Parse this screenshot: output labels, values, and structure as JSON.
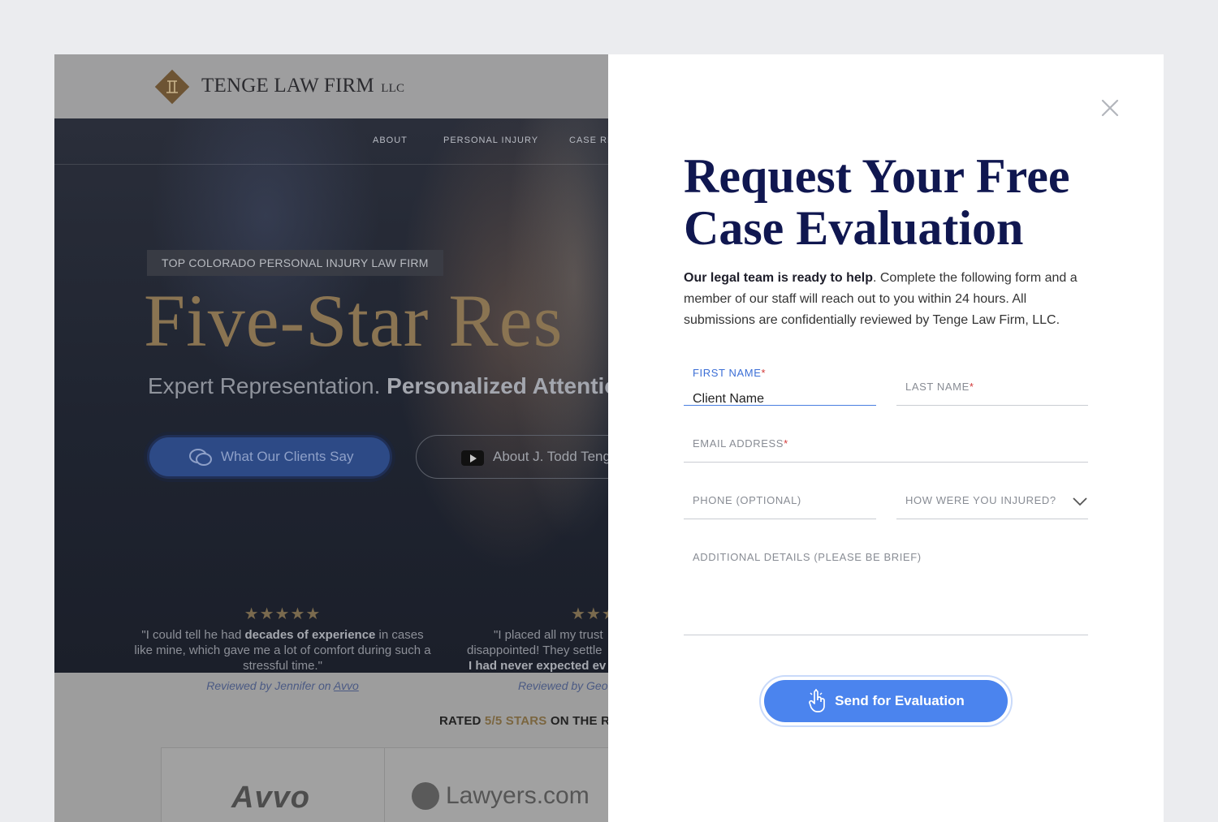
{
  "site": {
    "logo_text": "TENGE LAW FIRM",
    "logo_suffix": "LLC",
    "nav": [
      "ABOUT",
      "PERSONAL INJURY",
      "CASE RE"
    ],
    "eyebrow": "TOP COLORADO PERSONAL INJURY LAW FIRM",
    "hero_title": "Five-Star Res",
    "hero_sub_light": "Expert Representation.",
    "hero_sub_bold": "Personalized Attentio",
    "clients_button": "What Our Clients Say",
    "about_button": "About J. Todd Teng",
    "reviews": [
      {
        "stars": "★★★★★",
        "pre": "\"I could tell he had ",
        "bold": "decades of experience",
        "post": " in cases like mine, which gave me a lot of comfort during such a stressful time.\"",
        "by_pre": "Reviewed by Jennifer on ",
        "by_link": "Avvo"
      },
      {
        "stars": "★★★",
        "line1": "\"I placed all my trust",
        "line2": "disappointed! They settle",
        "line3": "I had never expected ev",
        "by_pre": "Reviewed by Geo"
      }
    ],
    "rated_pre": "RATED ",
    "rated_gold": "5/5 STARS",
    "rated_post": " ON THE R",
    "badges": [
      "Avvo",
      "Lawyers.com"
    ]
  },
  "modal": {
    "title": "Request Your Free Case Evaluation",
    "desc_bold": "Our legal team is ready to help",
    "desc_rest": ". Complete the following form and a member of our staff will reach out to you within 24 hours. All submissions are confidentially reviewed by Tenge Law Firm, LLC.",
    "fields": {
      "first_name": {
        "label": "FIRST NAME",
        "required": "*",
        "value": "Client Name"
      },
      "last_name": {
        "label": "LAST NAME",
        "required": "*"
      },
      "email": {
        "label": "EMAIL ADDRESS",
        "required": "*"
      },
      "phone": {
        "label": "PHONE (OPTIONAL)"
      },
      "injury": {
        "label": "HOW WERE YOU INJURED?"
      },
      "details": {
        "label": "ADDITIONAL DETAILS (PLEASE BE BRIEF)"
      }
    },
    "submit_label": "Send for Evaluation"
  },
  "colors": {
    "title_navy": "#101750",
    "accent_blue": "#4b84ee",
    "required_red": "#d23a3a",
    "gold": "#8a7452"
  },
  "icons": [
    "logo-diamond-icon",
    "close-icon",
    "chat-bubbles-icon",
    "youtube-play-icon",
    "chevron-down-icon",
    "tap-hand-icon"
  ]
}
